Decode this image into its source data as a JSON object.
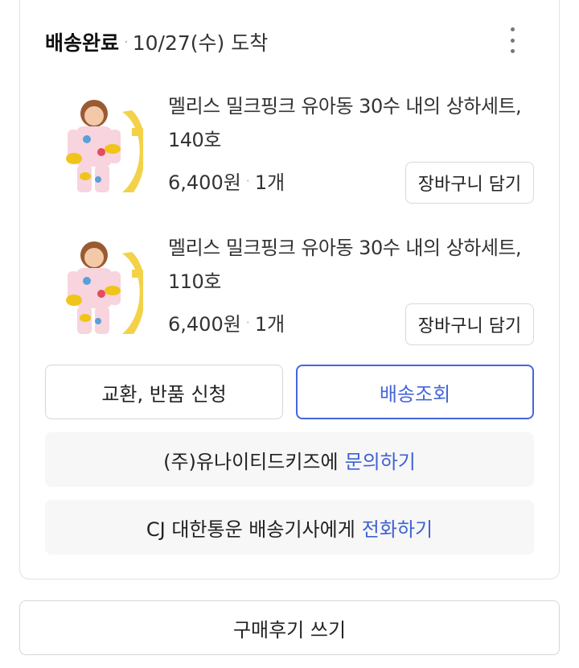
{
  "delivery": {
    "status": "배송완료",
    "arrival": "10/27(수) 도착"
  },
  "items": [
    {
      "name": "멜리스 밀크핑크 유아동 30수 내의 상하세트, 140호",
      "price": "6,400원",
      "quantity": "1개",
      "cart_button": "장바구니 담기"
    },
    {
      "name": "멜리스 밀크핑크 유아동 30수 내의 상하세트, 110호",
      "price": "6,400원",
      "quantity": "1개",
      "cart_button": "장바구니 담기"
    }
  ],
  "actions": {
    "exchange_return": "교환, 반품 신청",
    "track_delivery": "배송조회"
  },
  "seller_inquiry": {
    "text": "(주)유나이티드키즈에",
    "link": "문의하기"
  },
  "courier_call": {
    "text": "CJ 대한통운 배송기사에게",
    "link": "전화하기"
  },
  "review_button": "구매후기 쓰기",
  "colors": {
    "accent": "#4666d9",
    "link": "#3f62d1",
    "info_bg": "#f7f7f8",
    "border": "#d6d6d6"
  }
}
